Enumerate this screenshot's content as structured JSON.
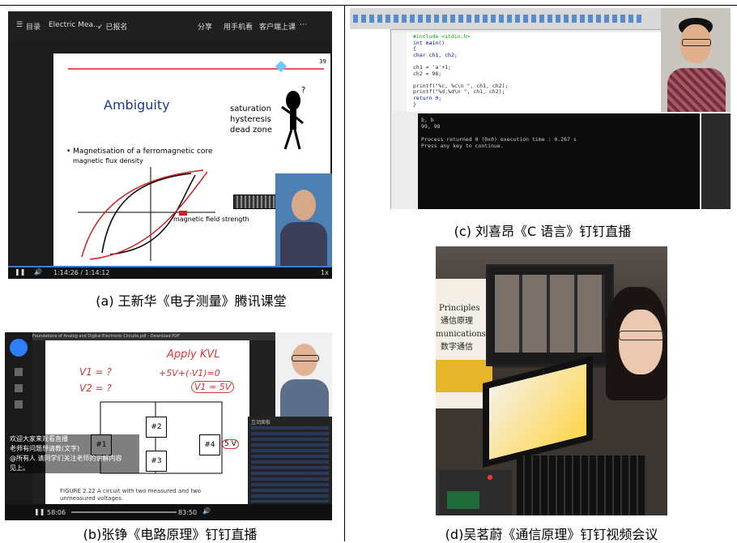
{
  "captions": {
    "a": "(a)  王新华《电子测量》腾讯课堂",
    "b": "(b)张铮《电路原理》钉钉直播",
    "c": "(c)  刘喜昂《C 语言》钉钉直播",
    "d": "(d)吴茗蔚《通信原理》钉钉视频会议"
  },
  "panel_a": {
    "menu_label": "目录",
    "course_title": "Electric Mea...",
    "enrolled": "✓ 已报名",
    "share": "分享",
    "phone_watch": "用手机看",
    "client_watch": "客户端上课",
    "more": "···",
    "slide_number": "39",
    "slide_title": "Ambiguity",
    "side_terms": [
      "saturation",
      "hysteresis",
      "dead zone"
    ],
    "bullet": "Magnetisation of a ferromagnetic core",
    "y_label": "magnetic flux density",
    "x_label": "magnetic field strength",
    "time": "1:14:26 / 1:14:12",
    "speed": "1x"
  },
  "panel_b": {
    "tab_title": "Foundations of Analog and Digital Electronic Circuits.pdf - Download PDF",
    "handwriting": [
      "Apply KVL",
      "+5V+(-V1)=0",
      "V1 = 5V",
      "V1 = ?",
      "V2 = ?"
    ],
    "box_labels": [
      "#1",
      "#2",
      "#3",
      "#4"
    ],
    "source_label": "5 V",
    "figure_caption": "FIGURE 2.22 A circuit with two measured and two unmeasured voltages.",
    "chat_lines": [
      "欢迎大家来观看直播",
      "老师有问题想请教(文字)",
      "@所有人 请同学们关注老师的讲解内容",
      "见上。"
    ],
    "chat_header": "互动面板",
    "time_left": "58:06",
    "time_right": "83:50"
  },
  "panel_c": {
    "code_lines": [
      "#include <stdio.h>",
      "int main()",
      "{",
      "    char ch1, ch2;",
      "",
      "    ch1 = 'a'+1;",
      "    ch2 = 98;",
      "",
      "    printf(\"%c, %c\\n \", ch1, ch2);",
      "    printf(\"%d,%d\\n \", ch1, ch2);",
      "    return 0;",
      "}"
    ],
    "console_lines": [
      "b, b",
      "99, 98",
      "",
      "Process returned 0 (0x0)   execution time : 0.267 s",
      "Press any key to continue."
    ]
  },
  "panel_d": {
    "book_words": [
      "Principles",
      "通信原理",
      "munications",
      "数字通信"
    ]
  }
}
